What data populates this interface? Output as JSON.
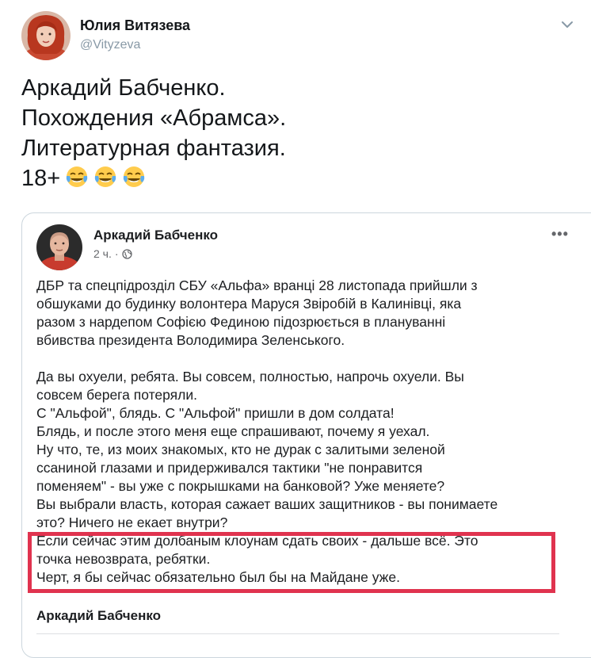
{
  "tweet": {
    "author": {
      "name": "Юлия Витязева",
      "handle": "@Vityzeva",
      "avatar_icon": "user-avatar-photo"
    },
    "menu_icon": "chevron-down-icon",
    "text_lines": [
      "Аркадий Бабченко.",
      "Похождения «Абрамса».",
      "Литературная фантазия.",
      "18+"
    ],
    "emoji": [
      "face-with-tears-of-joy",
      "face-with-tears-of-joy",
      "face-with-tears-of-joy"
    ]
  },
  "quoted_post": {
    "author": "Аркадий Бабченко",
    "time": "2 ч.",
    "separator": "·",
    "privacy_icon": "globe-icon",
    "more_icon": "more-horizontal-icon",
    "more_label": "•••",
    "paragraph_1": [
      "ДБР та  спецпідрозділ СБУ «Альфа» вранці 28 листопада прийшли з",
      "обшуками до будинку волонтера Маруся Звіробій  в Калинівці, яка",
      "разом з нардепом Софією Фединою підозрюється в плануванні",
      "вбивства президента Володимира Зеленського."
    ],
    "paragraph_2": [
      "Да вы охуели, ребята. Вы совсем, полностью, напрочь охуели. Вы",
      "совсем берега потеряли.",
      "С \"Альфой\", блядь. С \"Альфой\" пришли в дом солдата!",
      "Блядь, и после этого меня еще спрашивают, почему я уехал.",
      "Ну что, те, из моих знакомых, кто не дурак с залитыми зеленой",
      "ссаниной глазами и придерживался тактики \"не понравится",
      "поменяем\" - вы уже с покрышками на банковой? Уже меняете?",
      "Вы выбрали власть, которая сажает ваших защитников - вы понимаете",
      "это? Ничего не екает внутри?",
      "Если сейчас этим долбаным клоунам сдать своих - дальше всё. Это",
      "точка невозврата, ребятки.",
      "Черт, я бы сейчас обязательно был бы на Майдане уже."
    ],
    "footer_author": "Аркадий Бабченко"
  },
  "colors": {
    "highlight_border": "#e0334f",
    "handle_gray": "#8899a6"
  }
}
